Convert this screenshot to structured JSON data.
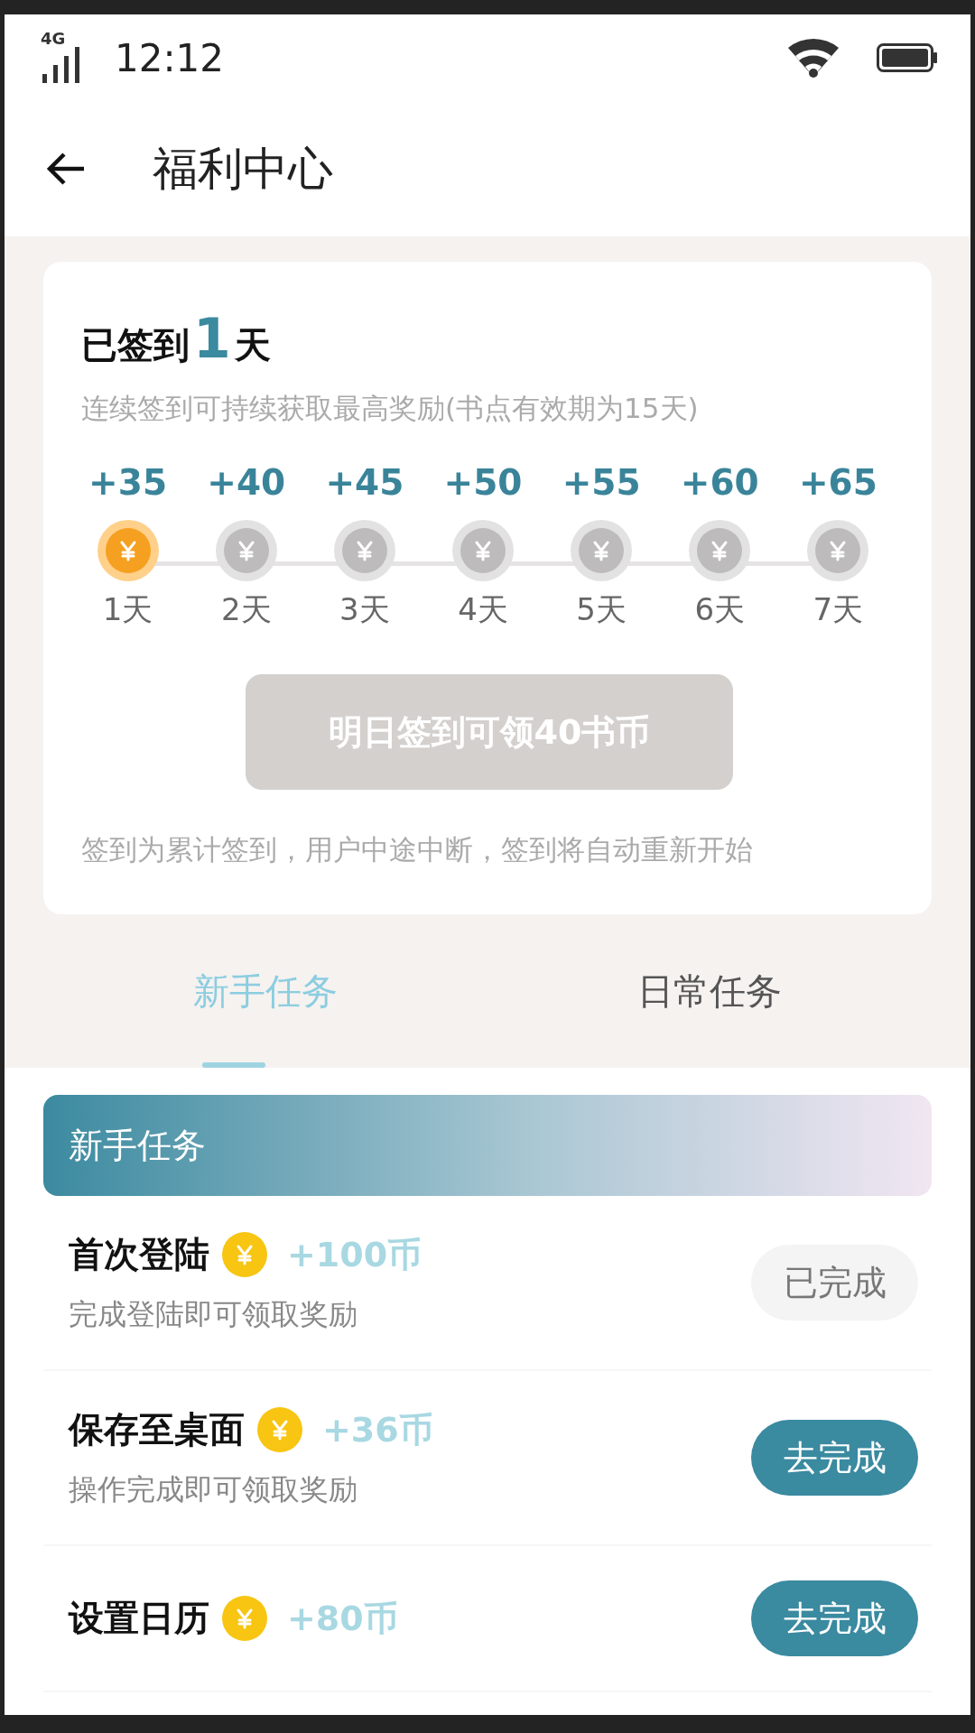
{
  "status_bar": {
    "network": "4G",
    "time": "12:12"
  },
  "header": {
    "title": "福利中心"
  },
  "checkin": {
    "title_prefix": "已签到",
    "count": "1",
    "title_suffix": "天",
    "subtitle": "连续签到可持续获取最高奖励(书点有效期为15天)",
    "days": [
      {
        "reward": "+35",
        "label": "1天",
        "signed": true
      },
      {
        "reward": "+40",
        "label": "2天",
        "signed": false
      },
      {
        "reward": "+45",
        "label": "3天",
        "signed": false
      },
      {
        "reward": "+50",
        "label": "4天",
        "signed": false
      },
      {
        "reward": "+55",
        "label": "5天",
        "signed": false
      },
      {
        "reward": "+60",
        "label": "6天",
        "signed": false
      },
      {
        "reward": "+65",
        "label": "7天",
        "signed": false
      }
    ],
    "button": {
      "label": "明日签到可领40书币",
      "disabled": true
    },
    "note": "签到为累计签到，用户中途中断，签到将自动重新开始"
  },
  "tabs": [
    {
      "label": "新手任务",
      "selected": true
    },
    {
      "label": "日常任务",
      "selected": false
    }
  ],
  "section": {
    "title": "新手任务"
  },
  "tasks": [
    {
      "title": "首次登陆",
      "reward": "+100币",
      "description": "完成登陆即可领取奖励",
      "button": "已完成",
      "completed": true
    },
    {
      "title": "保存至桌面",
      "reward": "+36币",
      "description": "操作完成即可领取奖励",
      "button": "去完成",
      "completed": false
    },
    {
      "title": "设置日历",
      "reward": "+80币",
      "button": "去完成",
      "completed": false
    }
  ]
}
